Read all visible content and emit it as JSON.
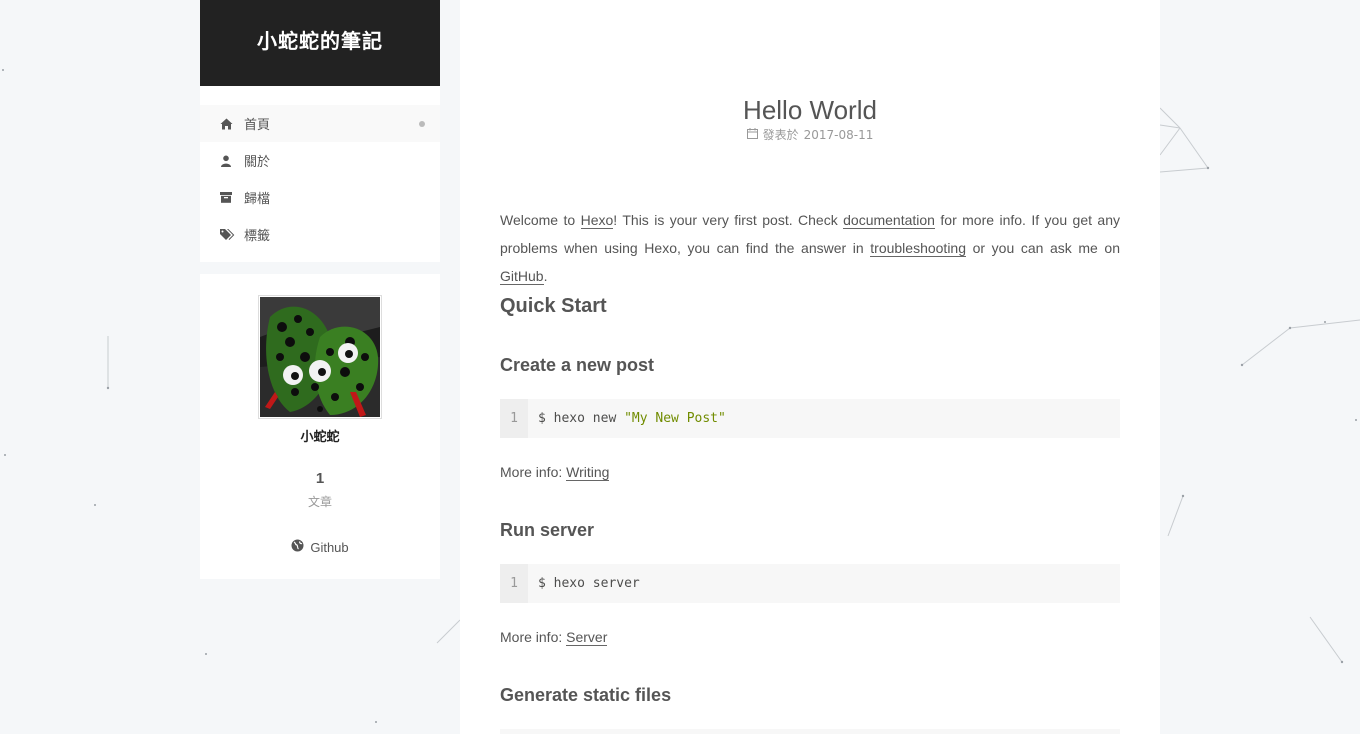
{
  "site": {
    "title": "小蛇蛇的筆記"
  },
  "menu": {
    "items": [
      {
        "label": "首頁",
        "icon": "home-icon",
        "active": true
      },
      {
        "label": "關於",
        "icon": "user-icon"
      },
      {
        "label": "歸檔",
        "icon": "archive-icon"
      },
      {
        "label": "標籤",
        "icon": "tags-icon"
      }
    ]
  },
  "profile": {
    "author": "小蛇蛇",
    "posts_count": "1",
    "posts_label": "文章",
    "social_label": "Github",
    "social_icon": "globe-icon"
  },
  "post": {
    "title": "Hello World",
    "meta_label": "發表於",
    "date": "2017-08-11",
    "intro": {
      "t1": "Welcome to ",
      "link_hexo": "Hexo",
      "t2": "! This is your very first post. Check ",
      "link_docs": "documentation",
      "t3": " for more info. If you get any problems when using Hexo, you can find the answer in ",
      "link_trouble": "troubleshooting",
      "t4": " or you can ask me on ",
      "link_github": "GitHub",
      "t5": "."
    },
    "quick_start": "Quick Start",
    "sections": [
      {
        "heading": "Create a new post",
        "line_no": "1",
        "cmd": "$ hexo new ",
        "cmd_str": "\"My New Post\"",
        "more_prefix": "More info: ",
        "more_link": "Writing"
      },
      {
        "heading": "Run server",
        "line_no": "1",
        "cmd": "$ hexo server",
        "cmd_str": "",
        "more_prefix": "More info: ",
        "more_link": "Server"
      },
      {
        "heading": "Generate static files"
      }
    ]
  },
  "colors": {
    "brand_bg": "#222222",
    "page_bg": "#f5f7f9",
    "code_string": "#718c00"
  }
}
